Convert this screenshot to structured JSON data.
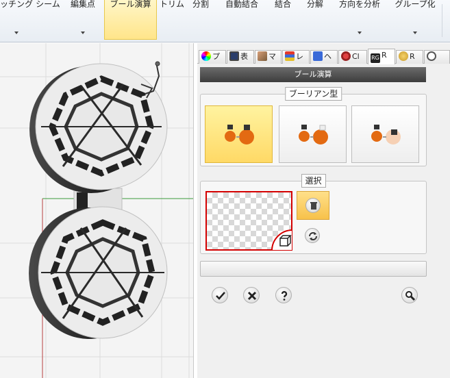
{
  "ribbon": {
    "tabs": [
      {
        "label": "ッチング"
      },
      {
        "label": "シーム"
      },
      {
        "label": "編集点"
      },
      {
        "label": "ブール演算"
      },
      {
        "label": "トリム"
      },
      {
        "label": "分割"
      },
      {
        "label": "自動結合"
      },
      {
        "label": "結合"
      },
      {
        "label": "分解"
      },
      {
        "label": "方向を分析"
      },
      {
        "label": "グループ化"
      }
    ],
    "active_tab": "ブール演算"
  },
  "panel": {
    "tabs": [
      {
        "label": "プ",
        "icon": "color-wheel-icon"
      },
      {
        "label": "表",
        "icon": "monitor-icon"
      },
      {
        "label": "マ",
        "icon": "material-icon"
      },
      {
        "label": "レ",
        "icon": "layer-icon"
      },
      {
        "label": "ヘ",
        "icon": "help-icon"
      },
      {
        "label": "Cl",
        "icon": "clip-icon"
      },
      {
        "label": "R",
        "icon": "rg-icon"
      },
      {
        "label": "R",
        "icon": "render-icon"
      },
      {
        "label": "",
        "icon": "clock-icon"
      }
    ],
    "active_tab_index": 6,
    "title": "ブール演算",
    "boolean_group": {
      "label": "ブーリアン型",
      "buttons": [
        {
          "name": "union",
          "icon": "boolean-union-icon"
        },
        {
          "name": "difference",
          "icon": "boolean-difference-icon"
        },
        {
          "name": "intersection",
          "icon": "boolean-intersection-icon"
        }
      ],
      "active_index": 0
    },
    "selection_group": {
      "label": "選択"
    },
    "accent_color": "#ffd966",
    "selection_border_color": "#d40000"
  }
}
